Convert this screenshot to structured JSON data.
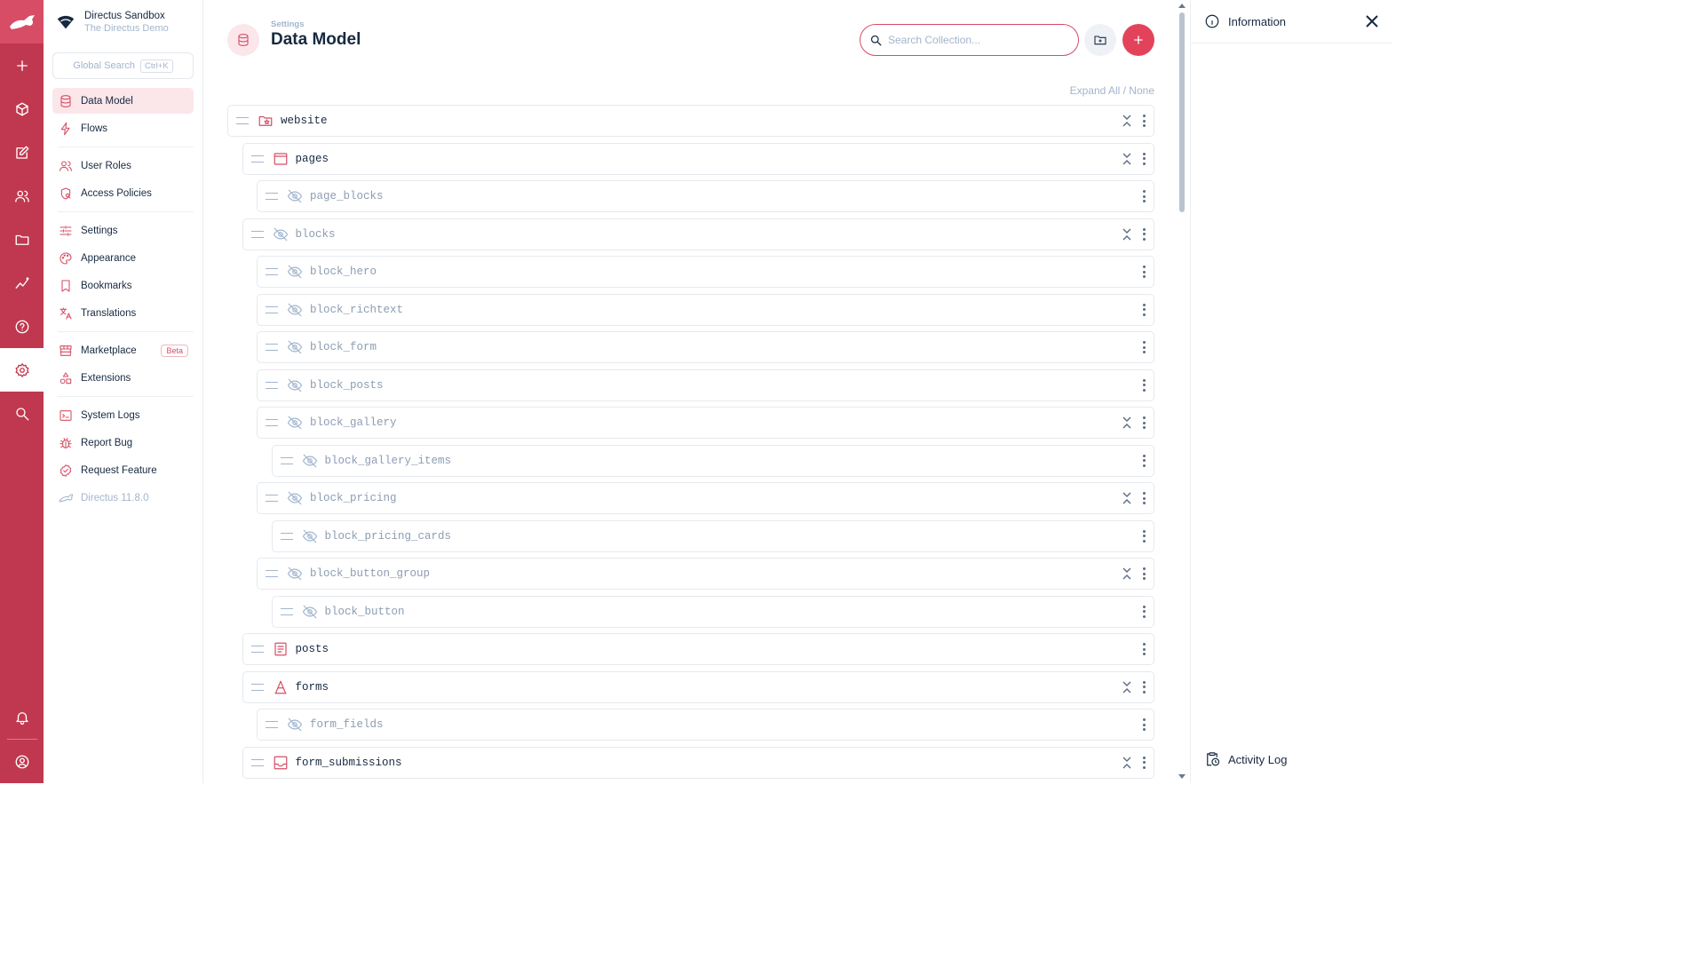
{
  "project": {
    "name": "Directus Sandbox",
    "description": "The Directus Demo"
  },
  "global_search": {
    "label": "Global Search",
    "shortcut": "Ctrl+K"
  },
  "nav": {
    "groups": [
      [
        {
          "label": "Data Model",
          "icon": "database-icon",
          "active": true
        },
        {
          "label": "Flows",
          "icon": "bolt-icon"
        }
      ],
      [
        {
          "label": "User Roles",
          "icon": "users-icon"
        },
        {
          "label": "Access Policies",
          "icon": "policy-icon"
        }
      ],
      [
        {
          "label": "Settings",
          "icon": "sliders-icon"
        },
        {
          "label": "Appearance",
          "icon": "palette-icon"
        },
        {
          "label": "Bookmarks",
          "icon": "bookmark-icon"
        },
        {
          "label": "Translations",
          "icon": "translate-icon"
        }
      ],
      [
        {
          "label": "Marketplace",
          "icon": "store-icon",
          "badge": "Beta"
        },
        {
          "label": "Extensions",
          "icon": "shapes-icon"
        }
      ],
      [
        {
          "label": "System Logs",
          "icon": "terminal-icon"
        },
        {
          "label": "Report Bug",
          "icon": "bug-icon"
        },
        {
          "label": "Request Feature",
          "icon": "verified-icon"
        },
        {
          "label": "Directus 11.8.0",
          "icon": "directus-icon",
          "muted": true
        }
      ]
    ]
  },
  "header": {
    "breadcrumb": "Settings",
    "title": "Data Model",
    "search_placeholder": "Search Collection..."
  },
  "expand_label": "Expand All / None",
  "collections": [
    {
      "name": "website",
      "depth": 0,
      "icon": "folder-special-icon",
      "hidden": false,
      "collapsible": true
    },
    {
      "name": "pages",
      "depth": 1,
      "icon": "web-asset-icon",
      "hidden": false,
      "collapsible": true
    },
    {
      "name": "page_blocks",
      "depth": 2,
      "icon": "visibility-off-icon",
      "hidden": true,
      "collapsible": false
    },
    {
      "name": "blocks",
      "depth": 1,
      "icon": "visibility-off-icon",
      "hidden": true,
      "collapsible": true
    },
    {
      "name": "block_hero",
      "depth": 2,
      "icon": "visibility-off-icon",
      "hidden": true,
      "collapsible": false
    },
    {
      "name": "block_richtext",
      "depth": 2,
      "icon": "visibility-off-icon",
      "hidden": true,
      "collapsible": false
    },
    {
      "name": "block_form",
      "depth": 2,
      "icon": "visibility-off-icon",
      "hidden": true,
      "collapsible": false
    },
    {
      "name": "block_posts",
      "depth": 2,
      "icon": "visibility-off-icon",
      "hidden": true,
      "collapsible": false
    },
    {
      "name": "block_gallery",
      "depth": 2,
      "icon": "visibility-off-icon",
      "hidden": true,
      "collapsible": true
    },
    {
      "name": "block_gallery_items",
      "depth": 3,
      "icon": "visibility-off-icon",
      "hidden": true,
      "collapsible": false
    },
    {
      "name": "block_pricing",
      "depth": 2,
      "icon": "visibility-off-icon",
      "hidden": true,
      "collapsible": true
    },
    {
      "name": "block_pricing_cards",
      "depth": 3,
      "icon": "visibility-off-icon",
      "hidden": true,
      "collapsible": false
    },
    {
      "name": "block_button_group",
      "depth": 2,
      "icon": "visibility-off-icon",
      "hidden": true,
      "collapsible": true
    },
    {
      "name": "block_button",
      "depth": 3,
      "icon": "visibility-off-icon",
      "hidden": true,
      "collapsible": false
    },
    {
      "name": "posts",
      "depth": 1,
      "icon": "article-icon",
      "hidden": false,
      "collapsible": false
    },
    {
      "name": "forms",
      "depth": 1,
      "icon": "font-icon",
      "hidden": false,
      "collapsible": true
    },
    {
      "name": "form_fields",
      "depth": 2,
      "icon": "visibility-off-icon",
      "hidden": true,
      "collapsible": false
    },
    {
      "name": "form_submissions",
      "depth": 1,
      "icon": "inbox-icon",
      "hidden": false,
      "collapsible": true
    }
  ],
  "sidebar": {
    "title": "Information",
    "activity": "Activity Log"
  },
  "colors": {
    "accent": "#d64d65",
    "module_bar": "#c0384f"
  }
}
